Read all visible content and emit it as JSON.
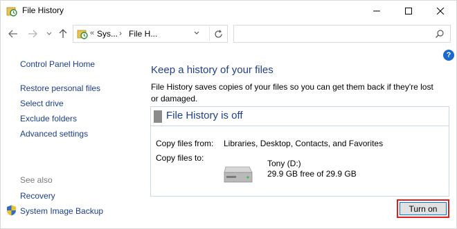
{
  "window": {
    "title": "File History",
    "icon": "file-history-icon",
    "controls": [
      "minimize-icon",
      "maximize-icon",
      "close-icon"
    ]
  },
  "navbar": {
    "breadcrumb": {
      "overflow": "«",
      "crumbs": [
        "Sys...",
        "File H..."
      ],
      "separator": "›"
    },
    "search_placeholder": ""
  },
  "sidebar": {
    "home": "Control Panel Home",
    "tasks": [
      "Restore personal files",
      "Select drive",
      "Exclude folders",
      "Advanced settings"
    ],
    "see_also_label": "See also",
    "see_also": [
      "Recovery",
      "System Image Backup"
    ]
  },
  "main": {
    "heading": "Keep a history of your files",
    "description": "File History saves copies of your files so you can get them back if they're lost or damaged.",
    "status": "File History is off",
    "copy_from_label": "Copy files from:",
    "copy_from_value": "Libraries, Desktop, Contacts, and Favorites",
    "copy_to_label": "Copy files to:",
    "drive_name": "Tony (D:)",
    "drive_free": "29.9 GB free of 29.9 GB",
    "turn_on_button": "Turn on"
  },
  "colors": {
    "link": "#1a3e8a",
    "heading": "#1e3f8a",
    "highlight": "#e21b1b",
    "accent": "#0078d7"
  }
}
